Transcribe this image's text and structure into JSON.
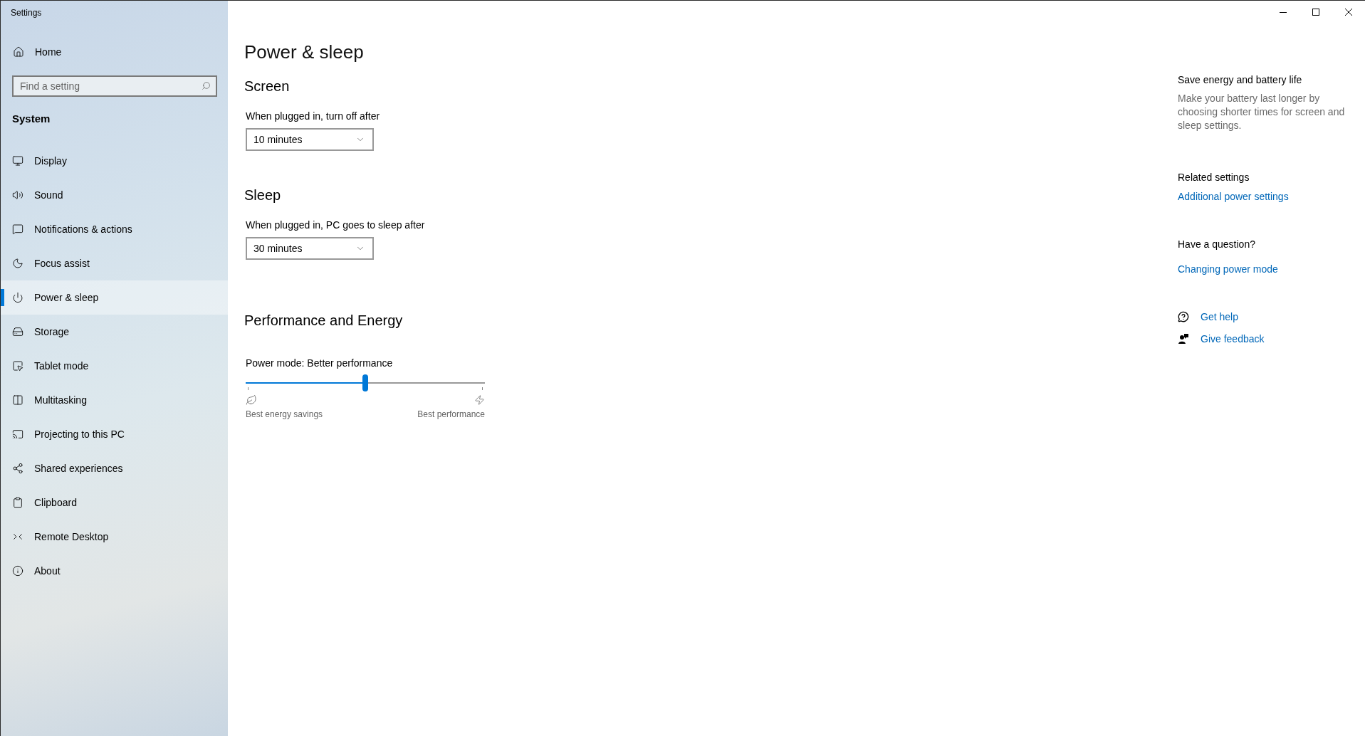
{
  "window": {
    "title": "Settings"
  },
  "sidebar": {
    "home": {
      "label": "Home"
    },
    "search": {
      "placeholder": "Find a setting"
    },
    "section": "System",
    "items": [
      {
        "label": "Display",
        "selected": false
      },
      {
        "label": "Sound",
        "selected": false
      },
      {
        "label": "Notifications & actions",
        "selected": false
      },
      {
        "label": "Focus assist",
        "selected": false
      },
      {
        "label": "Power & sleep",
        "selected": true
      },
      {
        "label": "Storage",
        "selected": false
      },
      {
        "label": "Tablet mode",
        "selected": false
      },
      {
        "label": "Multitasking",
        "selected": false
      },
      {
        "label": "Projecting to this PC",
        "selected": false
      },
      {
        "label": "Shared experiences",
        "selected": false
      },
      {
        "label": "Clipboard",
        "selected": false
      },
      {
        "label": "Remote Desktop",
        "selected": false
      },
      {
        "label": "About",
        "selected": false
      }
    ]
  },
  "page": {
    "title": "Power & sleep",
    "sections": [
      {
        "heading": "Screen",
        "settings": [
          {
            "kind": "dropdown",
            "label": "When plugged in, turn off after",
            "value": "10 minutes"
          }
        ]
      },
      {
        "heading": "Sleep",
        "settings": [
          {
            "kind": "dropdown",
            "label": "When plugged in, PC goes to sleep after",
            "value": "30 minutes"
          }
        ]
      },
      {
        "heading": "Performance and Energy",
        "settings": [
          {
            "kind": "slider",
            "label": "Power mode: Better performance",
            "level": 0.5,
            "min_label": "Best energy savings",
            "max_label": "Best performance"
          }
        ]
      }
    ]
  },
  "aside": {
    "tip": {
      "heading": "Save energy and battery life",
      "text": "Make your battery last longer by choosing shorter times for screen and sleep settings."
    },
    "related": {
      "heading": "Related settings",
      "links": [
        "Additional power settings"
      ]
    },
    "question": {
      "heading": "Have a question?",
      "links": [
        "Changing power mode"
      ]
    },
    "support_links": [
      {
        "kind": "help",
        "label": "Get help"
      },
      {
        "kind": "feedback",
        "label": "Give feedback"
      }
    ]
  }
}
